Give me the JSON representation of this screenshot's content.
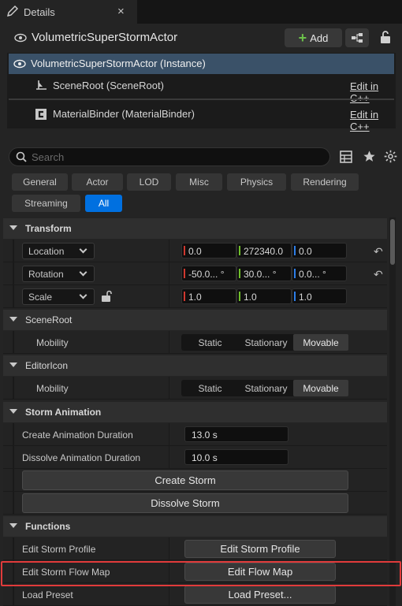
{
  "tab": {
    "title": "Details",
    "close": "×"
  },
  "actor": {
    "name": "VolumetricSuperStormActor",
    "add_label": "Add"
  },
  "components": {
    "instance": "VolumetricSuperStormActor (Instance)",
    "items": [
      {
        "label": "SceneRoot (SceneRoot)",
        "action": "Edit in C++"
      },
      {
        "label": "MaterialBinder (MaterialBinder)",
        "action": "Edit in C++"
      }
    ]
  },
  "search": {
    "placeholder": "Search"
  },
  "filters": {
    "row1": [
      "General",
      "Actor",
      "LOD",
      "Misc",
      "Physics",
      "Rendering"
    ],
    "row2": [
      "Streaming",
      "All"
    ],
    "active": "All"
  },
  "transform": {
    "header": "Transform",
    "location": {
      "mode": "Location",
      "x": "0.0",
      "y": "272340.0",
      "z": "0.0"
    },
    "rotation": {
      "mode": "Rotation",
      "x": "-50.0... °",
      "y": "30.0... °",
      "z": "0.0... °"
    },
    "scale": {
      "mode": "Scale",
      "x": "1.0",
      "y": "1.0",
      "z": "1.0"
    }
  },
  "sceneroot": {
    "header": "SceneRoot",
    "mobility_label": "Mobility",
    "options": [
      "Static",
      "Stationary",
      "Movable"
    ],
    "selected": "Movable"
  },
  "editoricon": {
    "header": "EditorIcon",
    "mobility_label": "Mobility",
    "options": [
      "Static",
      "Stationary",
      "Movable"
    ],
    "selected": "Movable"
  },
  "storm_animation": {
    "header": "Storm Animation",
    "create_duration_label": "Create Animation Duration",
    "create_duration_value": "13.0 s",
    "dissolve_duration_label": "Dissolve Animation Duration",
    "dissolve_duration_value": "10.0 s",
    "create_button": "Create Storm",
    "dissolve_button": "Dissolve Storm"
  },
  "functions": {
    "header": "Functions",
    "rows": [
      {
        "label": "Edit Storm Profile",
        "button": "Edit Storm Profile"
      },
      {
        "label": "Edit Storm Flow Map",
        "button": "Edit Flow Map"
      },
      {
        "label": "Load Preset",
        "button": "Load Preset..."
      }
    ]
  },
  "colors": {
    "accent": "#0070e0",
    "selection": "#3a5168",
    "highlight": "#e13b3b"
  }
}
